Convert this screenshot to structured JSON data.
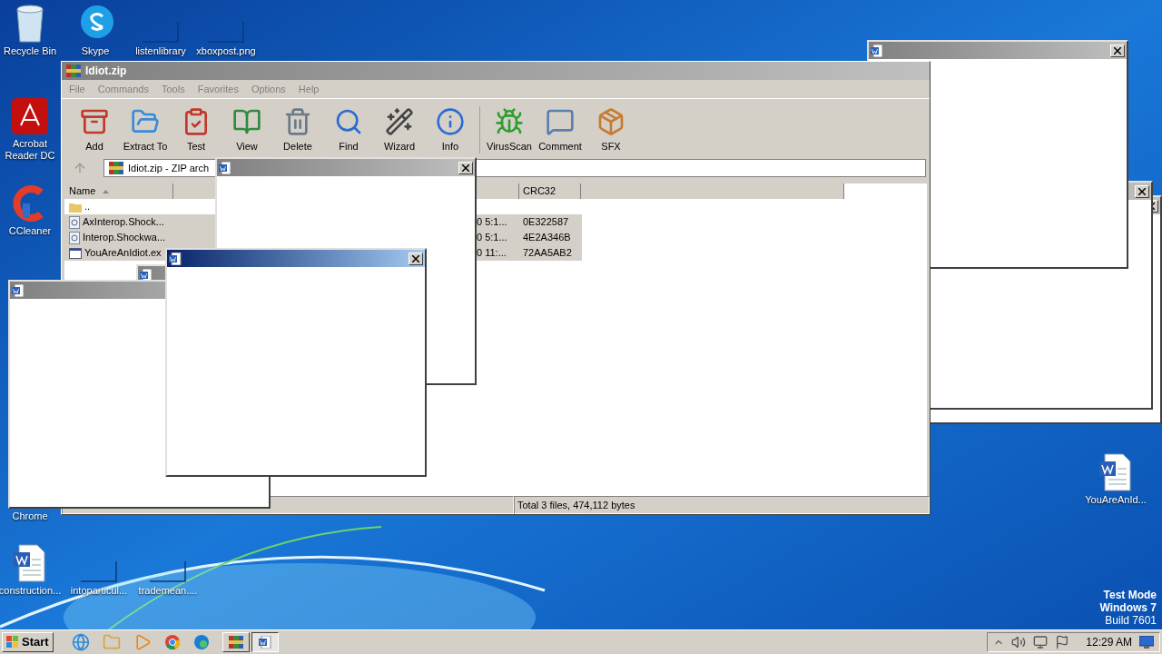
{
  "desktop_icons": [
    {
      "label": "Recycle Bin",
      "kind": "bin"
    },
    {
      "label": "Skype",
      "kind": "skype"
    },
    {
      "label": "listenlibrary",
      "kind": "blank"
    },
    {
      "label": "xboxpost.png",
      "kind": "blank"
    },
    {
      "label": "Acrobat Reader DC",
      "kind": "acrobat"
    },
    {
      "label": "CCleaner",
      "kind": "ccleaner"
    },
    {
      "label": "Chrome",
      "kind": "none"
    },
    {
      "label": "construction...",
      "kind": "word"
    },
    {
      "label": "intoparticul...",
      "kind": "blank"
    },
    {
      "label": "trademean....",
      "kind": "blank"
    },
    {
      "label": "YouAreAnId...",
      "kind": "word"
    }
  ],
  "archive_window": {
    "title": "Idiot.zip",
    "menu": [
      "File",
      "Commands",
      "Tools",
      "Favorites",
      "Options",
      "Help"
    ],
    "toolbar": [
      {
        "label": "Add",
        "kind": "add"
      },
      {
        "label": "Extract To",
        "kind": "extract"
      },
      {
        "label": "Test",
        "kind": "test"
      },
      {
        "label": "View",
        "kind": "view"
      },
      {
        "label": "Delete",
        "kind": "delete"
      },
      {
        "label": "Find",
        "kind": "find"
      },
      {
        "label": "Wizard",
        "kind": "wizard"
      },
      {
        "label": "Info",
        "kind": "info"
      },
      {
        "label": "VirusScan",
        "kind": "virus"
      },
      {
        "label": "Comment",
        "kind": "comment"
      },
      {
        "label": "SFX",
        "kind": "sfx"
      }
    ],
    "path": "Idiot.zip - ZIP arch",
    "columns": [
      "Name",
      "CRC32"
    ],
    "rows": [
      {
        "name": "..",
        "kind": "folder",
        "modified": "",
        "crc": "",
        "selected": false
      },
      {
        "name": "AxInterop.Shock...",
        "kind": "dll",
        "modified": "0 5:1...",
        "crc": "0E322587",
        "selected": true
      },
      {
        "name": "Interop.Shockwa...",
        "kind": "dll",
        "modified": "0 5:1...",
        "crc": "4E2A346B",
        "selected": true
      },
      {
        "name": "YouAreAnIdiot.ex",
        "kind": "exe",
        "modified": "0 11:...",
        "crc": "72AA5AB2",
        "selected": true
      }
    ],
    "status": "Total 3 files, 474,112 bytes"
  },
  "popups": [
    {
      "active": false
    },
    {
      "active": false
    },
    {
      "active": false
    },
    {
      "active": false
    },
    {
      "active": false
    },
    {
      "active": false
    },
    {
      "active": true
    }
  ],
  "os_notice": [
    "Test Mode",
    "Windows 7",
    "Build 7601"
  ],
  "taskbar": {
    "start": "Start",
    "quick_launch": [
      {
        "kind": "ie"
      },
      {
        "kind": "explorer"
      },
      {
        "kind": "media"
      },
      {
        "kind": "chrome"
      },
      {
        "kind": "edge"
      }
    ],
    "tasks": [
      {
        "kind": "winrar",
        "selected": false
      },
      {
        "kind": "word",
        "selected": true
      }
    ],
    "clock": "12:29 AM"
  }
}
